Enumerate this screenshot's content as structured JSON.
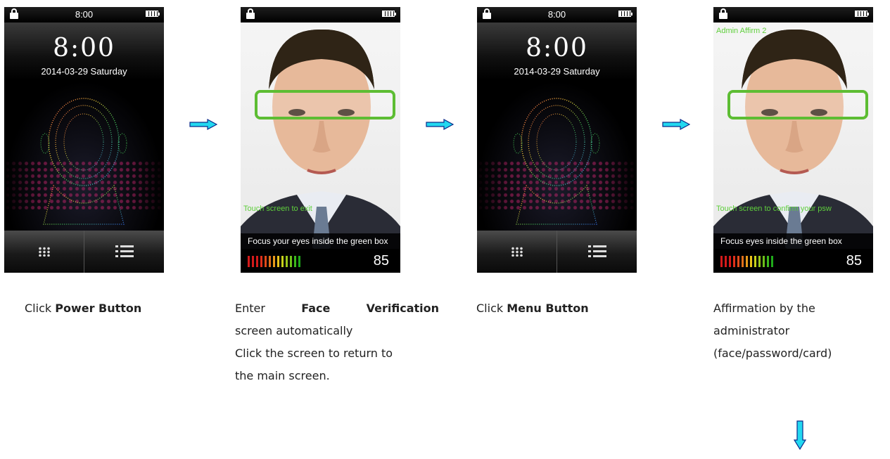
{
  "screens": {
    "home1": {
      "status_time": "8:00",
      "big_time": "8:00",
      "date": "2014-03-29  Saturday"
    },
    "verify": {
      "touch_text": "Touch screen to exit",
      "focus_text": "Focus your eyes inside the green box",
      "score": "85"
    },
    "home2": {
      "status_time": "8:00",
      "big_time": "8:00",
      "date": "2014-03-29  Saturday"
    },
    "admin": {
      "admin_text": "Admin Affirm 2",
      "touch_text": "Touch screen to confirm your psw",
      "focus_text": "Focus  eyes inside the green box",
      "score": "85"
    }
  },
  "captions": {
    "c1_pre": "Click ",
    "c1_bold": "Power Button",
    "c2_pre": "Enter",
    "c2_bold1": "Face",
    "c2_bold2": "Verification",
    "c2_line2": "screen automatically",
    "c2_line3": "Click the screen to return to",
    "c2_line4": "the main screen.",
    "c3_pre": "Click ",
    "c3_bold": "Menu Button",
    "c4_line1": "Affirmation by the",
    "c4_line2": "administrator",
    "c4_line3": "(face/password/card)"
  },
  "colors": {
    "arrow": "#22d8f0",
    "green_box": "#5dbd33",
    "meter": [
      "#d41a1a",
      "#d41a1a",
      "#d41a1a",
      "#e0301a",
      "#e04a1a",
      "#e0701a",
      "#e89a1a",
      "#e8c21a",
      "#c8d21a",
      "#9ac81a",
      "#6cc01a",
      "#3cb81a",
      "#1faa1a"
    ]
  },
  "icons": [
    "lock-icon",
    "battery-icon",
    "grid-menu-icon",
    "list-menu-icon",
    "arrow-right-icon",
    "arrow-down-icon"
  ]
}
